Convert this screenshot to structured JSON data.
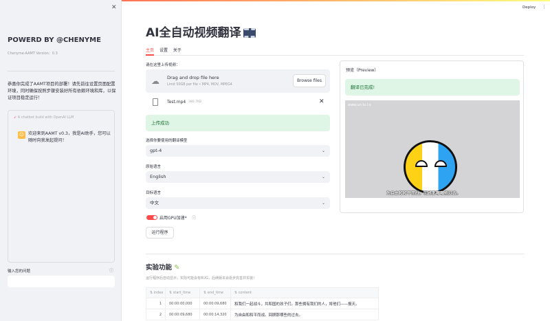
{
  "sidebar": {
    "close_icon": "close-icon",
    "title": "POWERD BY @CHENYME",
    "version": "Chenyme-AAMT Version：0.3",
    "message": "恭喜你完成了AAMT项目的部署！请先前往设置页面配置环境，同时确保按照步骤安装好所有依赖环境和库，以保证项目稳定运行！",
    "chatbot_caption": "A chatbot build with OpenAI LLM",
    "chat_message": "欢迎来到AAMT v0.3，我是AI助手，您可以随时向我发起提问！",
    "question_label": "输入您的问题",
    "question_value": ""
  },
  "header": {
    "deploy": "Deploy",
    "menu_icon": "more-vert-icon"
  },
  "main": {
    "title": "AI全自动视频翻译",
    "tabs": [
      {
        "label": "主页"
      },
      {
        "label": "设置"
      },
      {
        "label": "关于"
      }
    ],
    "upload_label": "请在这里上传视频：",
    "drop_text": "Drag and drop file here",
    "drop_limit": "Limit 50GB per file • MP4, MOV, MPEG4",
    "browse": "Browse files",
    "file": {
      "name": "Test.mp4",
      "size": "380.7KB"
    },
    "upload_success": "上传成功",
    "model_label": "选择你要使用的翻译模型",
    "model_value": "gpt-4",
    "source_label": "原始语言",
    "source_value": "English",
    "target_label": "目标语言",
    "target_value": "中文",
    "gpu_label": "启用GPU加速*",
    "gpu_enabled": true,
    "run": "运行程序"
  },
  "preview": {
    "title": "预览（Preview）",
    "done": "翻译已完成!",
    "watermark": "www.un lu.l.u",
    "subtitle": "为自由和和平而战。回顾那哪哪些过去。"
  },
  "experimental": {
    "title": "实验功能",
    "description": "运行程序后自动显示，实际可能会有BUG，后续版本会逐步完善并实装！",
    "columns": [
      "index",
      "start_time",
      "end_time",
      "content"
    ],
    "rows": [
      [
        "1",
        "00:00:00,000",
        "00:00:09,680",
        "和我们一起战斗，共和国的孩子们。那些拥有我们的人，将他们——报天。"
      ],
      [
        "2",
        "00:00:09,680",
        "00:00:14,320",
        "为自由和和平而战。回顾那哪些的过去。"
      ]
    ]
  }
}
